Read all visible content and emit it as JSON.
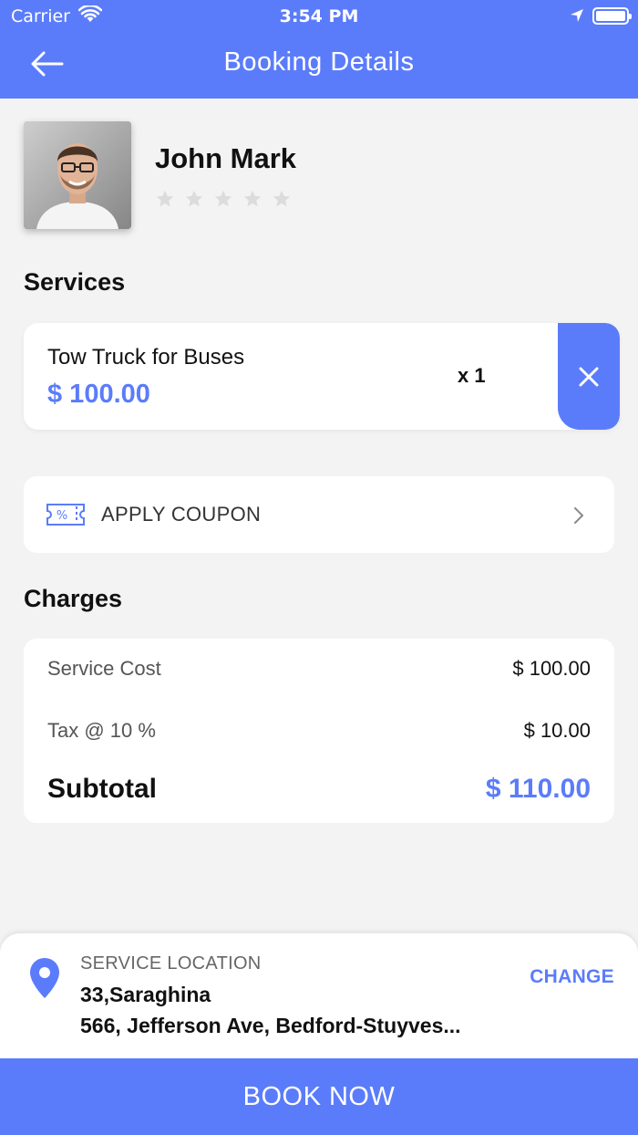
{
  "status_bar": {
    "carrier": "Carrier",
    "time": "3:54 PM"
  },
  "header": {
    "title": "Booking Details"
  },
  "profile": {
    "name": "John Mark",
    "rating": 0,
    "max_rating": 5
  },
  "sections": {
    "services": "Services",
    "charges": "Charges"
  },
  "service": {
    "name": "Tow Truck for Buses",
    "price": "$ 100.00",
    "quantity": "x 1"
  },
  "coupon": {
    "label": "APPLY COUPON"
  },
  "charges": {
    "service_cost_label": "Service Cost",
    "service_cost_value": "$ 100.00",
    "tax_label": "Tax @ 10 %",
    "tax_value": "$ 10.00",
    "subtotal_label": "Subtotal",
    "subtotal_value": "$ 110.00"
  },
  "location": {
    "caption": "SERVICE LOCATION",
    "line1": "33,Saraghina",
    "line2": "566, Jefferson Ave, Bedford-Stuyves...",
    "change_label": "CHANGE"
  },
  "actions": {
    "book_now": "BOOK NOW"
  },
  "colors": {
    "accent": "#5b7cfa",
    "background": "#f3f3f3",
    "star_empty": "#dcdcdc"
  }
}
